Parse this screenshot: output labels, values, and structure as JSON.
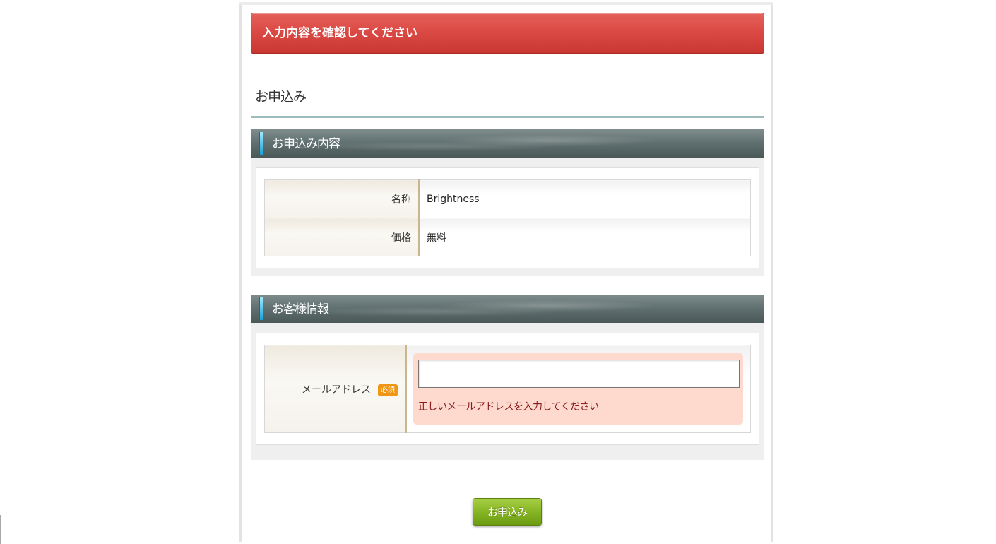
{
  "error_banner": {
    "text": "入力内容を確認してください"
  },
  "page_title": "お申込み",
  "sections": [
    {
      "title": "お申込み内容",
      "rows": [
        {
          "label": "名称",
          "value": "Brightness"
        },
        {
          "label": "価格",
          "value": "無料"
        }
      ]
    },
    {
      "title": "お客様情報",
      "email_field": {
        "label": "メールアドレス",
        "required_badge": "必須",
        "value": "",
        "placeholder": "",
        "error_message": "正しいメールアドレスを入力してください"
      }
    }
  ],
  "submit_button": {
    "label": "お申込み"
  },
  "colors": {
    "error_banner": "#dc4a45",
    "title_rule": "#9dbcbc",
    "section_header": "#5f6e6e",
    "required_badge": "#f09612",
    "error_box": "#fdd9ce",
    "error_text": "#8b1a1a",
    "submit_button": "#86b524"
  }
}
